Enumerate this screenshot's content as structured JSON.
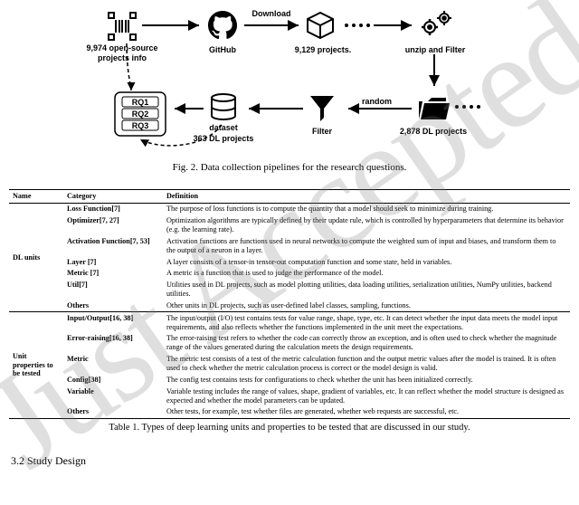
{
  "diagram": {
    "download": "Download",
    "random": "random",
    "projects_info_line1": "9,974 open-source",
    "projects_info_line2": "projects info",
    "github": "GitHub",
    "projects_9129": "9,129 projects.",
    "unzip": "unzip and Filter",
    "dataset_label": "dataset",
    "dataset_count": "363 DL projects",
    "filter": "Filter",
    "dl_projects": "2,878 DL projects",
    "rq1": "RQ1",
    "rq2": "RQ2",
    "rq3": "RQ3"
  },
  "figure_caption": "Fig. 2.  Data collection pipelines for the research questions.",
  "headers": {
    "name": "Name",
    "category": "Category",
    "definition": "Definition"
  },
  "groups": [
    {
      "name": "DL units",
      "rows": [
        {
          "cat": "Loss Function[7]",
          "def": "The purpose of loss functions is to compute the quantity that a model should seek to minimize during training."
        },
        {
          "cat": "Optimizer[7, 27]",
          "def": "Optimization algorithms are typically defined by their update rule, which is controlled by hyperparameters that determine its behavior (e.g. the learning rate)."
        },
        {
          "cat": "Activation Function[7, 53]",
          "def": "Activation functions are functions used in neural networks to compute the weighted sum of input and biases, and transform them to the output of a neuron in a layer."
        },
        {
          "cat": "Layer [7]",
          "def": "A layer consists of a tensor-in tensor-out computation function and some state, held in variables."
        },
        {
          "cat": "Metric [7]",
          "def": "A metric is a function that is used to judge the performance of the model."
        },
        {
          "cat": "Util[7]",
          "def": "Utilities used in DL projects, such as model plotting utilities, data loading utilities, serialization utilities, NumPy utilities, backend utilities."
        },
        {
          "cat": "Others",
          "def": "Other units in DL projects, such as user-defined label classes, sampling, functions."
        }
      ]
    },
    {
      "name": "Unit properties to be tested",
      "rows": [
        {
          "cat": "Input/Output[16, 38]",
          "def": "The input/output (I/O) test contains tests for value range, shape, type, etc. It can detect whether the input data meets the model input requirements, and also reflects whether the functions implemented in the unit meet the expectations."
        },
        {
          "cat": "Error-raising[16, 38]",
          "def": "The error-raising test refers to whether the code can correctly throw an exception, and is often used to check whether the magnitude range of the values generated during the calculation meets the design requirements."
        },
        {
          "cat": "Metric",
          "def": "The metric test consists of a test of the metric calculation function and the output metric values after the model is trained. It is often used to check whether the metric calculation process is correct or the model design is valid."
        },
        {
          "cat": "Config[38]",
          "def": "The config test contains tests for configurations to check whether the unit has been initialized correctly."
        },
        {
          "cat": "Variable",
          "def": "Variable testing includes the range of values, shape, gradient of variables, etc. It can reflect whether the model structure is designed as expected and whether the model parameters can be updated."
        },
        {
          "cat": "Others",
          "def": "Other tests, for example, test whether files are generated, whether web requests are successful, etc."
        }
      ]
    }
  ],
  "table_caption": "Table 1.  Types of deep learning units and properties to be tested that are discussed in our study.",
  "section": "3.2   Study Design"
}
